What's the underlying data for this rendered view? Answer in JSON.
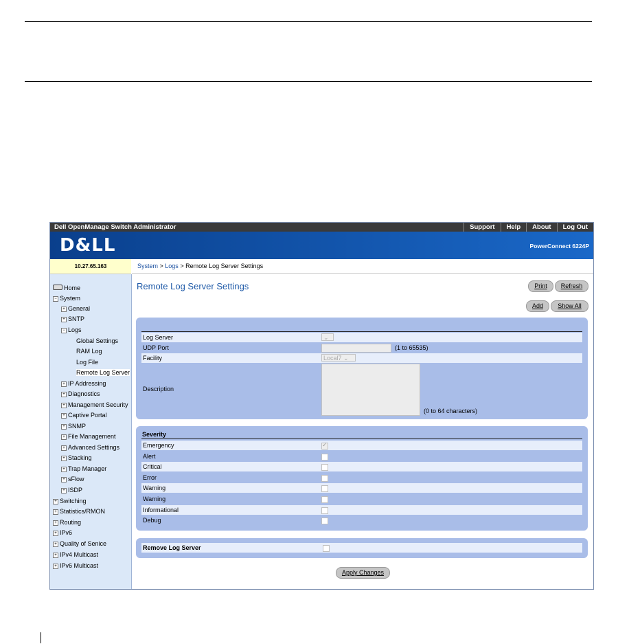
{
  "topbar": {
    "title": "Dell OpenManage Switch Administrator",
    "links": [
      "Support",
      "Help",
      "About",
      "Log Out"
    ]
  },
  "banner": {
    "logo": "D&LL",
    "product": "PowerConnect 6224P"
  },
  "ip": "10.27.65.163",
  "breadcrumb": {
    "part1": "System",
    "sep1": " > ",
    "part2": "Logs",
    "sep2": " > ",
    "current": "Remote Log Server Settings"
  },
  "nav": {
    "home": "Home",
    "system": "System",
    "general": "General",
    "sntp": "SNTP",
    "logs": "Logs",
    "global_settings": "Global Settings",
    "ram_log": "RAM Log",
    "log_file": "Log File",
    "remote_log_server": "Remote Log Server",
    "ip_addressing": "IP Addressing",
    "diagnostics": "Diagnostics",
    "management_security": "Management Security",
    "captive_portal": "Captive Portal",
    "snmp": "SNMP",
    "file_management": "File Management",
    "advanced_settings": "Advanced Settings",
    "stacking": "Stacking",
    "trap_manager": "Trap Manager",
    "sflow": "sFlow",
    "isdp": "ISDP",
    "switching": "Switching",
    "statistics": "Statistics/RMON",
    "routing": "Routing",
    "ipv6": "IPv6",
    "qos": "Quality of Senice",
    "ipv4_multicast": "IPv4 Multicast",
    "ipv6_multicast": "IPv6 Multicast"
  },
  "page": {
    "title": "Remote Log Server Settings",
    "print": "Print",
    "refresh": "Refresh",
    "add": "Add",
    "show_all": "Show All"
  },
  "form": {
    "log_server_label": "Log Server",
    "udp_port_label": "UDP Port",
    "udp_port_hint": "(1 to 65535)",
    "facility_label": "Facility",
    "facility_value": "Local7",
    "description_label": "Description",
    "description_hint": "(0 to 64 characters)"
  },
  "severity": {
    "header": "Severity",
    "items": [
      "Emergency",
      "Alert",
      "Critical",
      "Error",
      "Warning",
      "Warning",
      "Informational",
      "Debug"
    ],
    "checked": [
      true,
      false,
      false,
      false,
      false,
      false,
      false,
      false
    ]
  },
  "remove": {
    "label": "Remove Log Server"
  },
  "apply": "Apply Changes"
}
